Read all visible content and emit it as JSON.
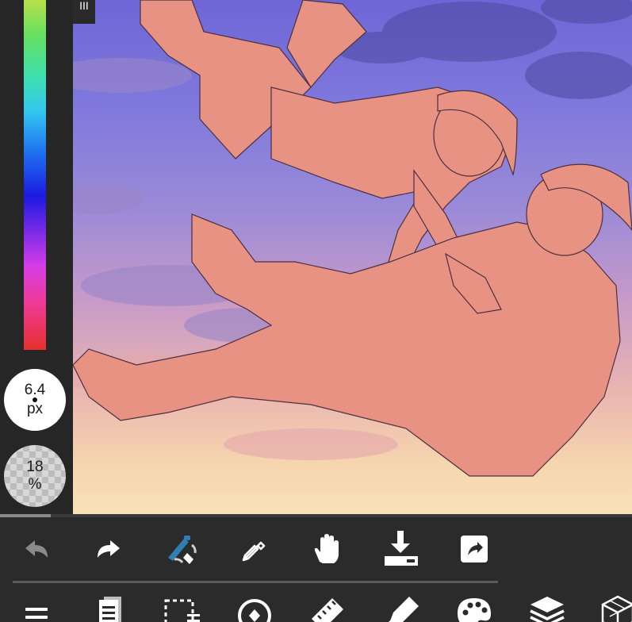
{
  "side_panel": {
    "brush_size": {
      "value": "6.4",
      "unit": "px"
    },
    "opacity": {
      "value": "18",
      "unit": "%"
    }
  },
  "menu_handle": {
    "glyph": "III"
  },
  "canvas_scroll_position": 0.08,
  "toolbar_top": {
    "tools": [
      {
        "icon": "undo-icon"
      },
      {
        "icon": "redo-icon"
      },
      {
        "icon": "brush-eraser-swap-icon"
      },
      {
        "icon": "eyedropper-icon"
      },
      {
        "icon": "hand-icon"
      },
      {
        "icon": "download-icon"
      },
      {
        "icon": "share-icon"
      }
    ]
  },
  "toolbar_bottom": {
    "tools": [
      {
        "icon": "menu-icon"
      },
      {
        "icon": "pages-icon"
      },
      {
        "icon": "selection-icon"
      },
      {
        "icon": "transform-icon"
      },
      {
        "icon": "ruler-icon"
      },
      {
        "icon": "pen-icon"
      },
      {
        "icon": "palette-icon"
      },
      {
        "icon": "layers-icon"
      },
      {
        "icon": "3d-cube-icon"
      }
    ]
  },
  "colors": {
    "panel_bg": "#262626",
    "toolbar_bg": "#2b2b2b",
    "icon_color": "#ffffff",
    "accent_blue": "#2f7fb6",
    "sky_top": "#6e66d6",
    "sky_bottom": "#f8e2b8",
    "figure_fill": "#e89283"
  }
}
